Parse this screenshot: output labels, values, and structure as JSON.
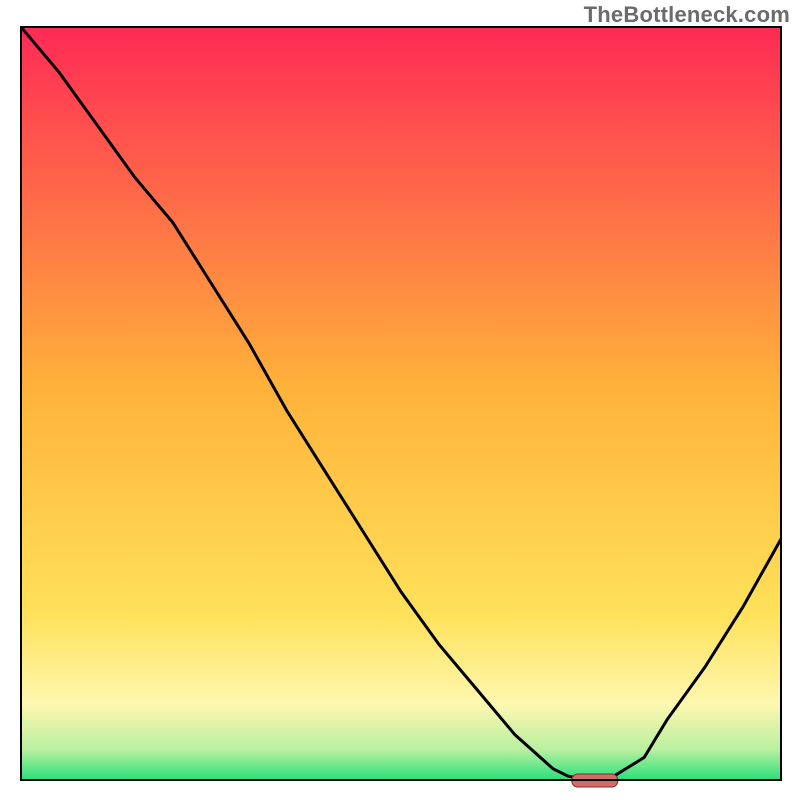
{
  "watermark": "TheBottleneck.com",
  "colors": {
    "gradient_top": "#ff2a55",
    "gradient_mid": "#ffc837",
    "gradient_low": "#fff47a",
    "gradient_base": "#29e07a",
    "curve": "#000000",
    "marker_fill": "#d46a6a",
    "marker_stroke": "#7f2d2d",
    "frame": "#000000"
  },
  "chart_data": {
    "type": "line",
    "title": "",
    "xlabel": "",
    "ylabel": "",
    "x": [
      0.0,
      0.05,
      0.1,
      0.15,
      0.2,
      0.25,
      0.3,
      0.35,
      0.4,
      0.45,
      0.5,
      0.55,
      0.6,
      0.65,
      0.7,
      0.72,
      0.75,
      0.78,
      0.82,
      0.85,
      0.9,
      0.95,
      1.0
    ],
    "values": [
      1.0,
      0.94,
      0.87,
      0.8,
      0.74,
      0.66,
      0.58,
      0.49,
      0.41,
      0.33,
      0.25,
      0.18,
      0.12,
      0.06,
      0.015,
      0.005,
      0.0,
      0.005,
      0.03,
      0.08,
      0.15,
      0.23,
      0.32
    ],
    "xlim": [
      0,
      1
    ],
    "ylim": [
      0,
      1
    ],
    "annotations": [
      {
        "kind": "marker",
        "x": 0.755,
        "y": 0.0,
        "label": ""
      }
    ]
  }
}
